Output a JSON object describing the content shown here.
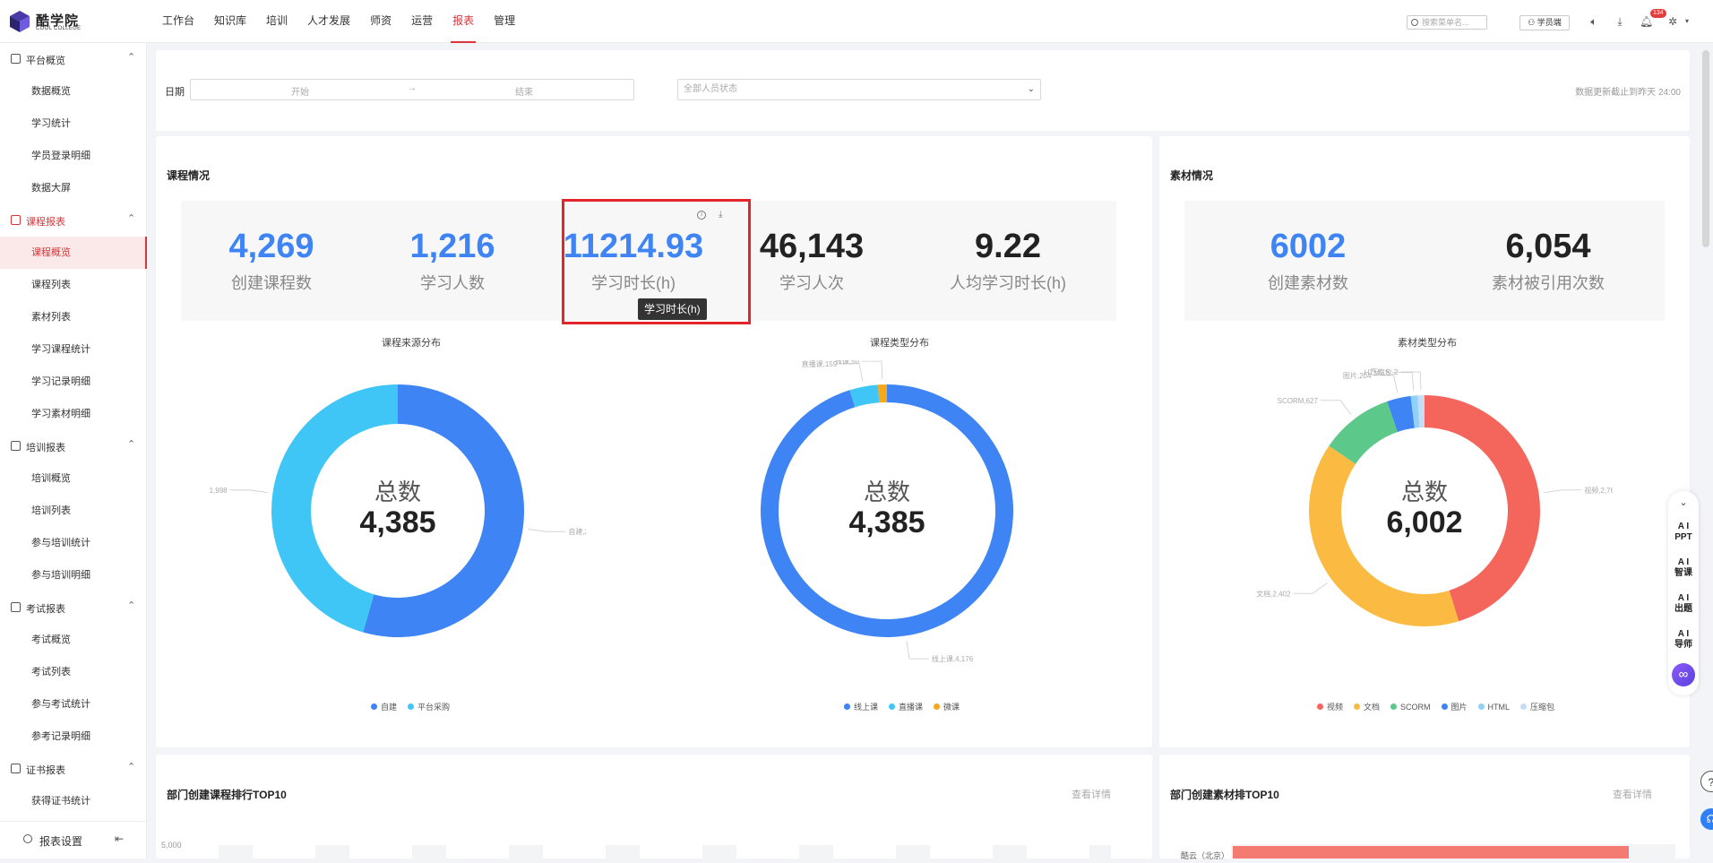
{
  "app": {
    "name": "酷学院",
    "name_en": "COOL COLLEGE"
  },
  "nav": {
    "items": [
      "工作台",
      "知识库",
      "培训",
      "人才发展",
      "师资",
      "运营",
      "报表",
      "管理"
    ],
    "active": 6
  },
  "header": {
    "search_placeholder": "搜索菜单名...",
    "learner_label": "学员端",
    "notif_count": "134"
  },
  "sidebar": {
    "groups": [
      {
        "label": "平台概览",
        "items": [
          "数据概览",
          "学习统计",
          "学员登录明细",
          "数据大屏"
        ]
      },
      {
        "label": "课程报表",
        "items": [
          "课程概览",
          "课程列表",
          "素材列表",
          "学习课程统计",
          "学习记录明细",
          "学习素材明细"
        ]
      },
      {
        "label": "培训报表",
        "items": [
          "培训概览",
          "培训列表",
          "参与培训统计",
          "参与培训明细"
        ]
      },
      {
        "label": "考试报表",
        "items": [
          "考试概览",
          "考试列表",
          "参与考试统计",
          "参考记录明细"
        ]
      },
      {
        "label": "证书报表",
        "items": [
          "获得证书统计"
        ]
      }
    ],
    "footer": "报表设置"
  },
  "filter": {
    "date_label": "日期",
    "start_placeholder": "开始",
    "arrow": "→",
    "end_placeholder": "结束",
    "status_placeholder": "全部人员状态",
    "update_note": "数据更新截止到昨天 24:00"
  },
  "course": {
    "title": "课程情况",
    "stats": [
      {
        "value": "4,269",
        "label": "创建课程数"
      },
      {
        "value": "1,216",
        "label": "学习人数"
      },
      {
        "value": "11214.93",
        "label": "学习时长(h)"
      },
      {
        "value": "46,143",
        "label": "学习人次"
      },
      {
        "value": "9.22",
        "label": "人均学习时长(h)"
      }
    ],
    "tooltip": "学习时长(h)"
  },
  "material": {
    "title": "素材情况",
    "stats": [
      {
        "value": "6002",
        "label": "创建素材数"
      },
      {
        "value": "6,054",
        "label": "素材被引用次数"
      }
    ]
  },
  "charts": {
    "total_label": "总数",
    "colors": {
      "blue": "#3e84f5",
      "cyan": "#40c6f6",
      "orange": "#f6a81c",
      "red": "#f4665c",
      "yellow": "#fbbb42",
      "green": "#5cc98a",
      "lightblue": "#8fd1f9"
    },
    "legend_source": [
      "自建",
      "平台采购"
    ],
    "legend_type": [
      "线上课",
      "直播课",
      "微课"
    ],
    "legend_material": [
      "视频",
      "文档",
      "SCORM",
      "图片",
      "HTML",
      "压缩包"
    ]
  },
  "chart_data": [
    {
      "type": "pie",
      "title": "课程来源分布",
      "total": "4,385",
      "slices": [
        {
          "name": "自建",
          "value": 2387,
          "label": "自建,2,387"
        },
        {
          "name": "平台采购",
          "value": 1998,
          "label": "平台采购,1,998"
        }
      ]
    },
    {
      "type": "pie",
      "title": "课程类型分布",
      "total": "4,385",
      "slices": [
        {
          "name": "线上课",
          "value": 4176,
          "label": "线上课,4,176"
        },
        {
          "name": "直播课",
          "value": 159,
          "label": "直播课,159"
        },
        {
          "name": "微课",
          "value": 50,
          "label": "微课,50"
        }
      ]
    },
    {
      "type": "pie",
      "title": "素材类型分布",
      "total": "6,002",
      "slices": [
        {
          "name": "视频",
          "value": 2764,
          "label": "视频,2,764"
        },
        {
          "name": "文档",
          "value": 2402,
          "label": "文档,2,402"
        },
        {
          "name": "SCORM",
          "value": 627,
          "label": "SCORM,627"
        },
        {
          "name": "图片",
          "value": 204,
          "label": "图片,204"
        },
        {
          "name": "HTML",
          "value": 3,
          "label": "HTML,3"
        },
        {
          "name": "压缩包",
          "value": 2,
          "label": "压缩包,2"
        }
      ]
    }
  ],
  "rank": {
    "course_title": "部门创建课程排行TOP10",
    "material_title": "部门创建素材排TOP10",
    "more": "查看详情",
    "axis_top": "5,000",
    "dept_label": "酷云（北京）"
  },
  "ai": {
    "items": [
      "A I\nPPT",
      "A I\n智课",
      "A I\n出题",
      "A I\n导师"
    ]
  }
}
